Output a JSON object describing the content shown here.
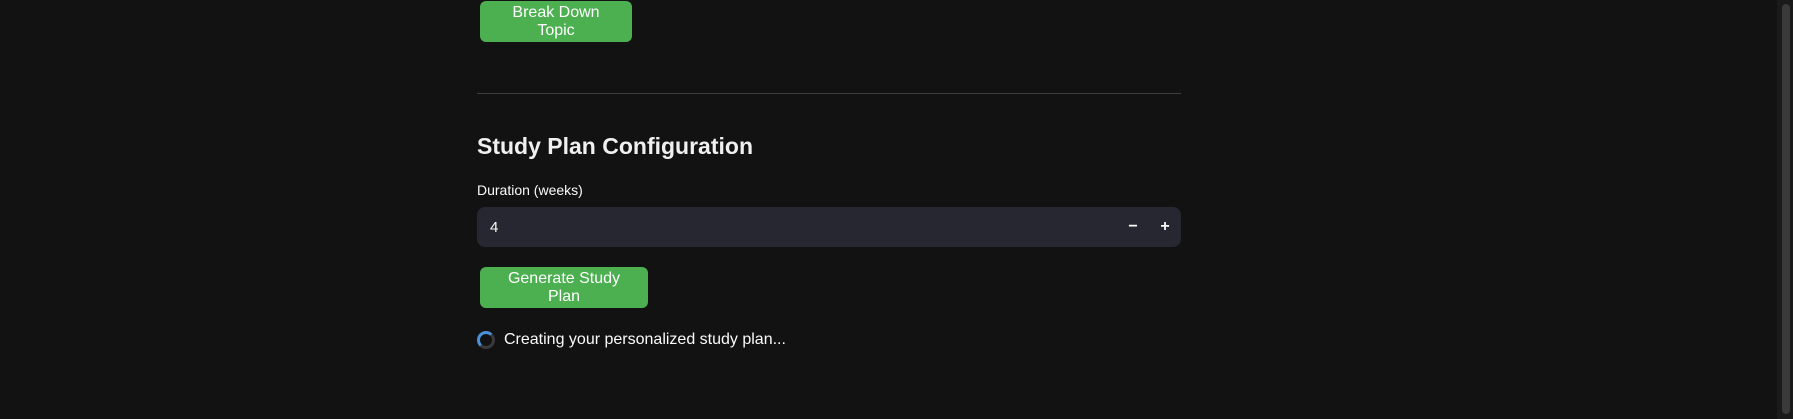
{
  "topic": {
    "breakdown_button_label": "Break Down Topic"
  },
  "study_plan": {
    "section_title": "Study Plan Configuration",
    "duration_label": "Duration (weeks)",
    "duration_value": "4",
    "decrement_symbol": "−",
    "increment_symbol": "+",
    "generate_button_label": "Generate Study Plan",
    "status_text": "Creating your personalized study plan..."
  },
  "colors": {
    "background": "#121212",
    "button_green": "#4caf50",
    "input_background": "#262730",
    "spinner_accent": "#4a90d9"
  }
}
